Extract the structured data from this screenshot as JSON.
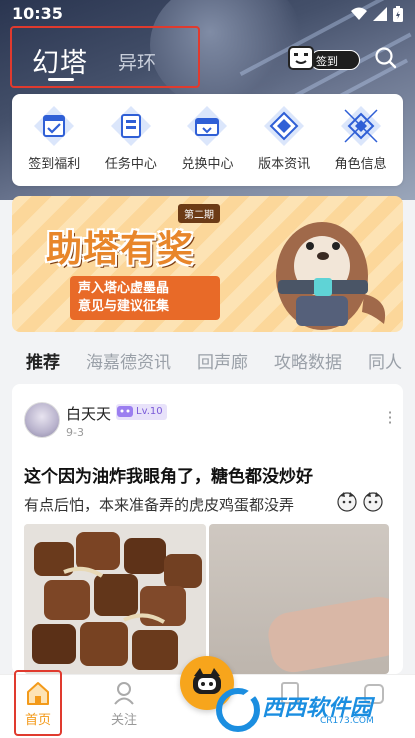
{
  "status_bar": {
    "time": "10:35"
  },
  "header": {
    "tabs": [
      {
        "label": "幻塔",
        "active": true
      },
      {
        "label": "异环",
        "active": false
      }
    ],
    "checkin_label": "签到"
  },
  "quick_menu": [
    {
      "label": "签到福利",
      "icon": "calendar-check-icon"
    },
    {
      "label": "任务中心",
      "icon": "task-icon"
    },
    {
      "label": "兑换中心",
      "icon": "exchange-icon"
    },
    {
      "label": "版本资讯",
      "icon": "diamond-icon"
    },
    {
      "label": "角色信息",
      "icon": "character-icon"
    }
  ],
  "banner": {
    "title": "助塔有奖",
    "edition": "第二期",
    "subtitle_line1": "声入塔心虚墨晶",
    "subtitle_line2": "意见与建议征集"
  },
  "categories": [
    {
      "label": "推荐",
      "active": true
    },
    {
      "label": "海嘉德资讯",
      "active": false
    },
    {
      "label": "回声廊",
      "active": false
    },
    {
      "label": "攻略数据",
      "active": false
    },
    {
      "label": "同人",
      "active": false
    }
  ],
  "post": {
    "author": "白天天",
    "level": "Lv.10",
    "date": "9-3",
    "title": "这个因为油炸我眼角了，糖色都没炒好",
    "body": "有点后怕，本来准备弄的虎皮鸡蛋都没弄"
  },
  "bottom_nav": [
    {
      "label": "首页",
      "active": true
    },
    {
      "label": "关注",
      "active": false
    }
  ],
  "watermark": {
    "text": "西西软件园",
    "sub": "CR173.COM"
  },
  "colors": {
    "accent": "#f5a623",
    "highlight_box": "#e03a2e",
    "level_purple": "#7a5ad8"
  }
}
